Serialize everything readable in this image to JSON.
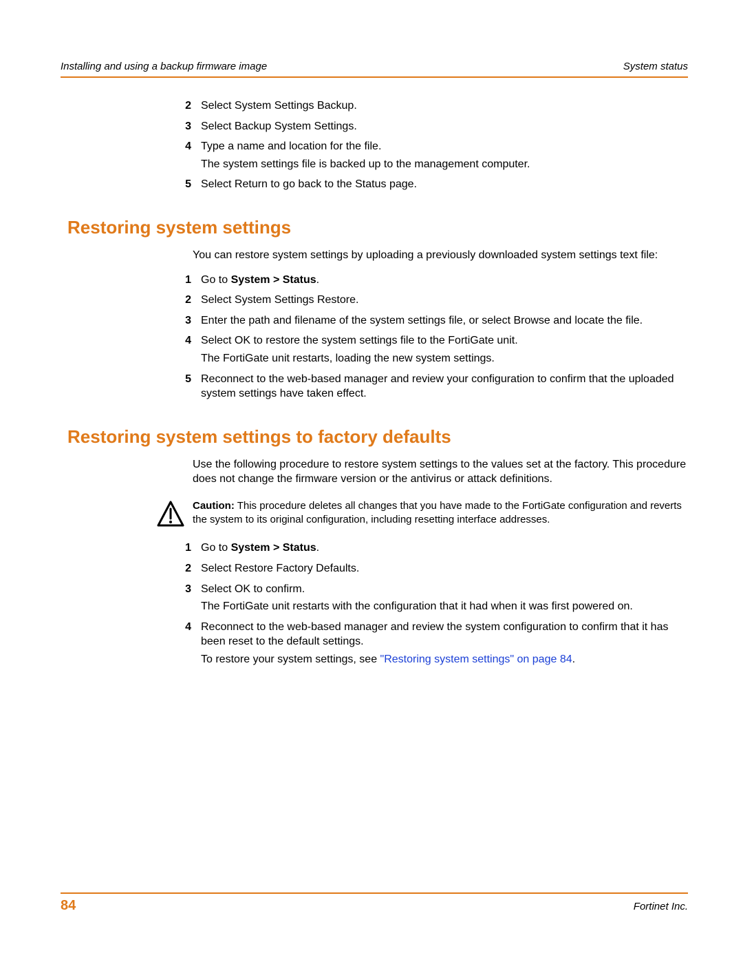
{
  "header": {
    "left": "Installing and using a backup firmware image",
    "right": "System status"
  },
  "topList": [
    {
      "n": "2",
      "t1": "Select System Settings Backup."
    },
    {
      "n": "3",
      "t1": "Select Backup System Settings."
    },
    {
      "n": "4",
      "t1": "Type a name and location for the file.",
      "t2": "The system settings file is backed up to the management computer."
    },
    {
      "n": "5",
      "t1": "Select Return to go back to the Status page."
    }
  ],
  "sect1": {
    "title": "Restoring system settings",
    "intro": "You can restore system settings by uploading a previously downloaded system settings text file:",
    "list": [
      {
        "n": "1",
        "pre": "Go to ",
        "bold": "System > Status",
        "post": "."
      },
      {
        "n": "2",
        "t1": "Select System Settings Restore."
      },
      {
        "n": "3",
        "t1": "Enter the path and filename of the system settings file, or select Browse and locate the file."
      },
      {
        "n": "4",
        "t1": "Select OK to restore the system settings file to the FortiGate unit.",
        "t2": "The FortiGate unit restarts, loading the new system settings."
      },
      {
        "n": "5",
        "t1": "Reconnect to the web-based manager and review your configuration to confirm that the uploaded system settings have taken effect."
      }
    ]
  },
  "sect2": {
    "title": "Restoring system settings to factory defaults",
    "intro": "Use the following procedure to restore system settings to the values set at the factory. This procedure does not change the firmware version or the antivirus or attack definitions.",
    "caution_label": "Caution:",
    "caution": " This procedure deletes all changes that you have made to the FortiGate configuration and reverts the system to its original configuration, including resetting interface addresses.",
    "list": [
      {
        "n": "1",
        "pre": "Go to ",
        "bold": "System > Status",
        "post": "."
      },
      {
        "n": "2",
        "t1": "Select Restore Factory Defaults."
      },
      {
        "n": "3",
        "t1": "Select OK to confirm.",
        "t2": "The FortiGate unit restarts with the configuration that it had when it was first powered on."
      },
      {
        "n": "4",
        "t1": "Reconnect to the web-based manager and review the system configuration to confirm that it has been reset to the default settings.",
        "link_pre": "To restore your system settings, see ",
        "link": "\"Restoring system settings\" on page 84",
        "link_post": "."
      }
    ]
  },
  "footer": {
    "page": "84",
    "company": "Fortinet Inc."
  }
}
